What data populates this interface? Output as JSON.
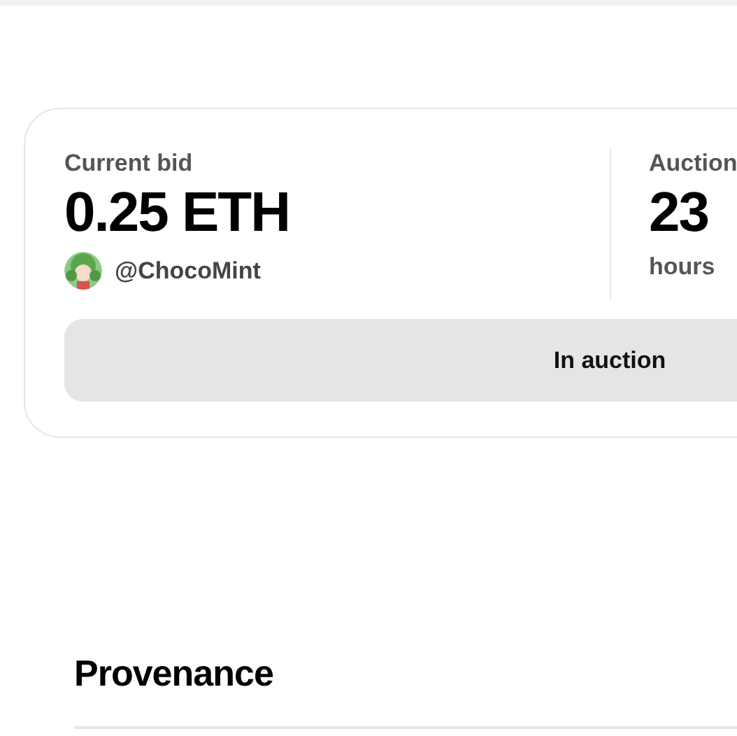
{
  "bid_card": {
    "bid_label": "Current bid",
    "bid_amount": "0.25 ETH",
    "bidder": {
      "handle": "@ChocoMint"
    },
    "auction_label": "Auction",
    "auction_value": "23",
    "auction_unit": "hours",
    "status_button": "In auction"
  },
  "provenance": {
    "title": "Provenance"
  }
}
